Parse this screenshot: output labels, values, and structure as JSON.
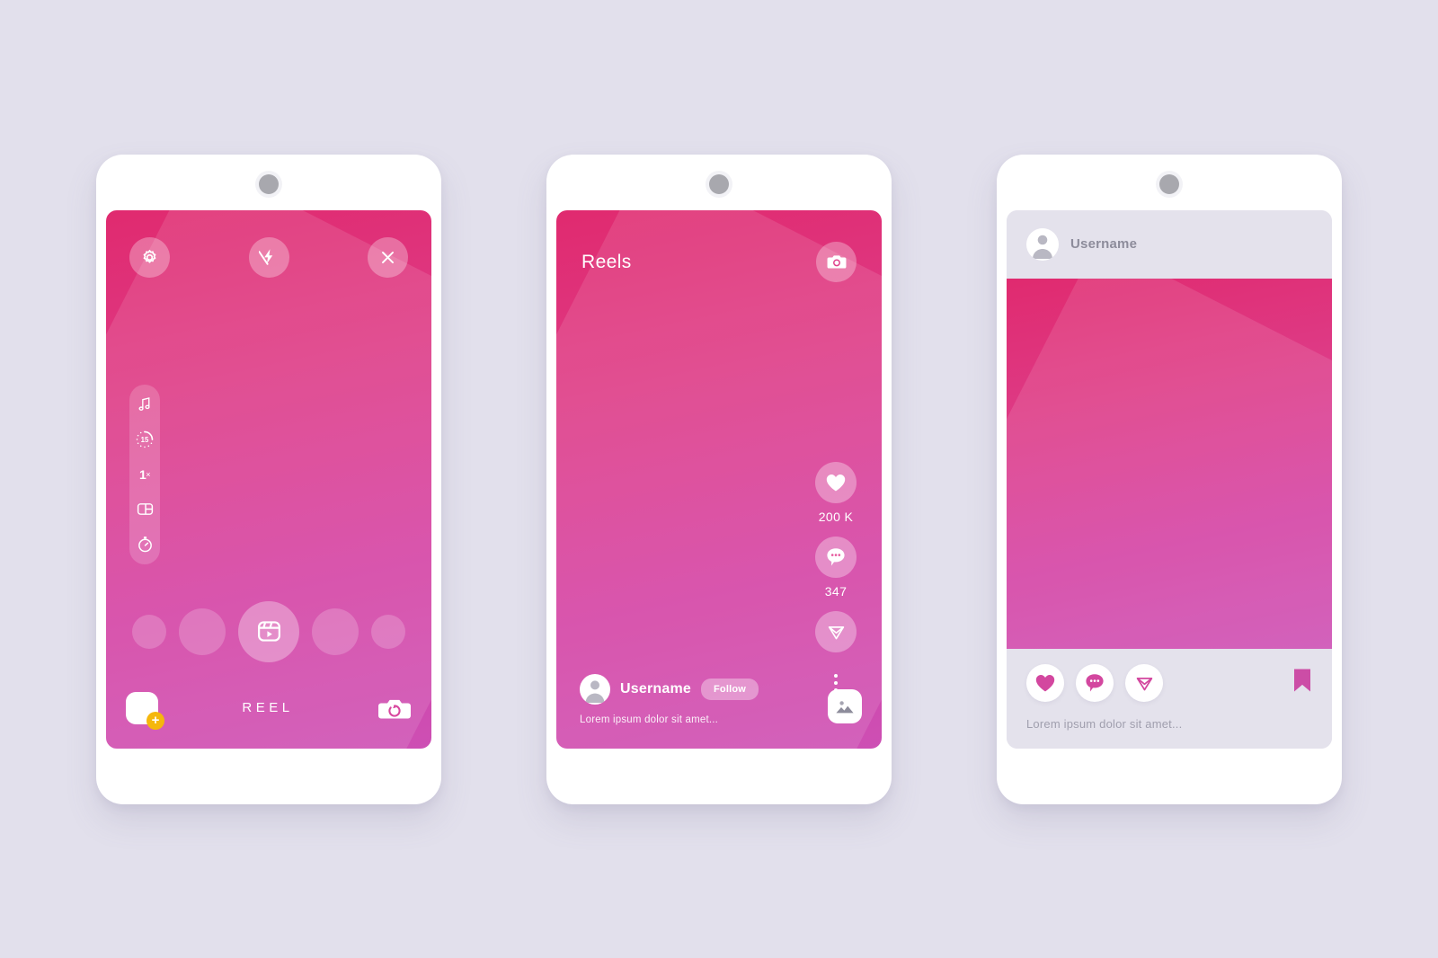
{
  "page": {
    "background_color": "#e2e0ec",
    "title": "Social media reels app UI screens"
  },
  "palette": {
    "gradient_from": "#e02a6f",
    "gradient_to": "#cd4fb4",
    "accent_orange": "#f5b70d",
    "accent_pink": "#d3479f",
    "frame_white": "#ffffff",
    "grey_text": "#8d8c9b",
    "panel_grey": "#e4e2ec"
  },
  "screens": [
    {
      "id": "camera-recorder",
      "top_controls": [
        {
          "name": "settings-button",
          "icon": "gear-icon"
        },
        {
          "name": "flash-off-button",
          "icon": "flash-off-icon"
        },
        {
          "name": "close-button",
          "icon": "close-icon"
        }
      ],
      "tool_rail": [
        {
          "name": "audio-tool",
          "icon": "music-note-icon",
          "label": ""
        },
        {
          "name": "duration-tool",
          "icon": "timer-dial-icon",
          "label": "15"
        },
        {
          "name": "speed-tool",
          "icon": "speed-icon",
          "label": "1",
          "suffix": "×"
        },
        {
          "name": "layout-tool",
          "icon": "layout-split-icon",
          "label": ""
        },
        {
          "name": "timer-tool",
          "icon": "stopwatch-icon",
          "label": ""
        }
      ],
      "carousel": {
        "items": [
          "small",
          "medium",
          "record",
          "medium",
          "small"
        ],
        "record_icon": "reel-play-icon"
      },
      "bottom_bar": {
        "gallery_thumb": "gallery-thumbnail",
        "gallery_badge": "+",
        "mode_label": "REEL",
        "flip_camera_icon": "camera-flip-icon"
      }
    },
    {
      "id": "reels-viewer",
      "header": {
        "title": "Reels",
        "camera_button_icon": "camera-icon"
      },
      "actions": [
        {
          "name": "like-button",
          "icon": "heart-filled-icon",
          "count": "200 K"
        },
        {
          "name": "comment-button",
          "icon": "comment-dots-icon",
          "count": "347"
        },
        {
          "name": "share-button",
          "icon": "send-icon",
          "count": ""
        },
        {
          "name": "more-options-button",
          "icon": "dots-vertical-icon",
          "count": ""
        }
      ],
      "footer": {
        "avatar": "user-avatar",
        "username": "Username",
        "follow_label": "Follow",
        "caption": "Lorem ipsum dolor sit amet...",
        "gallery_icon": "image-icon"
      }
    },
    {
      "id": "feed-post",
      "header": {
        "avatar": "user-avatar",
        "username": "Username"
      },
      "footer": {
        "actions": [
          {
            "name": "like-button",
            "icon": "heart-filled-icon"
          },
          {
            "name": "comment-button",
            "icon": "comment-dots-icon"
          },
          {
            "name": "share-button",
            "icon": "send-icon"
          }
        ],
        "save_button": {
          "name": "bookmark-button",
          "icon": "bookmark-filled-icon"
        },
        "caption": "Lorem ipsum dolor sit amet..."
      }
    }
  ]
}
